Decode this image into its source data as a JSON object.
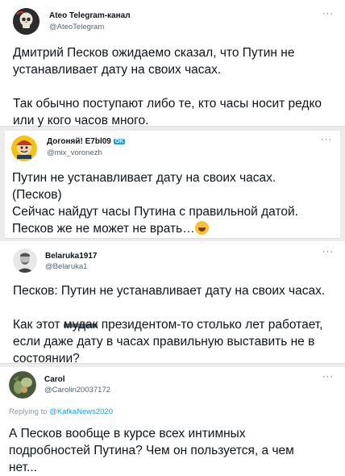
{
  "tweets": [
    {
      "name": "Ateo Telegram-канал",
      "handle": "@AteoTelegram",
      "more": "···",
      "lines": [
        "Дмитрий Песков ожидаемо сказал, что Путин не",
        "устанавливает дату на своих часах.",
        "",
        "Так обычно поступают либо те, кто часы носит редко",
        "или у кого часов много."
      ]
    },
    {
      "name": "Догоняй! E7bl09",
      "badge": "OK",
      "handle": "@mix_voronezh",
      "more": "···",
      "lines": [
        "Путин не устанавливает дату на своих часах.",
        "(Песков)",
        "Сейчас найдут часы Путина с правильной датой.",
        "Песков же не может не врать…"
      ]
    },
    {
      "name": "Belaruka1917",
      "handle": "@Belaruka1",
      "more": "···",
      "line1": "Песков: Путин не устанавливает дату на своих часах.",
      "line2_a": "Как этот ",
      "line2_censored": "мудак",
      "line2_b": " президентом-то столько лет работает,",
      "line3": "если даже дату в часах правильную выставить не в",
      "line4": "состоянии?"
    },
    {
      "name": "Carol",
      "handle": "@Carolin20037172",
      "more": "···",
      "replying_prefix": "Replying to ",
      "replying_to": "@KafkaNews2020",
      "lines": [
        "А Песков вообще в курсе всех интимных",
        "подробностей Путина? Чем он пользуется, а чем",
        "нет..."
      ]
    }
  ],
  "icons": {
    "ateo_avatar": "skull-avatar-icon",
    "dogonyai_avatar": "cartoon-avatar-icon",
    "belaruka_avatar": "portrait-avatar-icon",
    "carol_avatar": "nature-avatar-icon",
    "emoji": "laughing-emoji-icon"
  }
}
